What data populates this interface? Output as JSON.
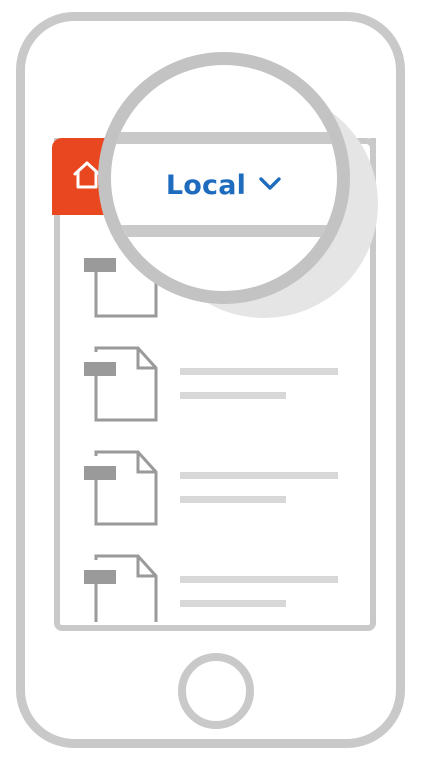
{
  "header": {
    "location_label": "Local"
  },
  "files": [
    {
      "id": 1
    },
    {
      "id": 2
    },
    {
      "id": 3
    },
    {
      "id": 4
    }
  ],
  "colors": {
    "accent": "#e8471f",
    "link": "#1f6cbf",
    "outline": "#c9c9c9"
  },
  "icons": {
    "home": "home-icon",
    "chevron": "chevron-down-icon",
    "file": "file-icon"
  }
}
